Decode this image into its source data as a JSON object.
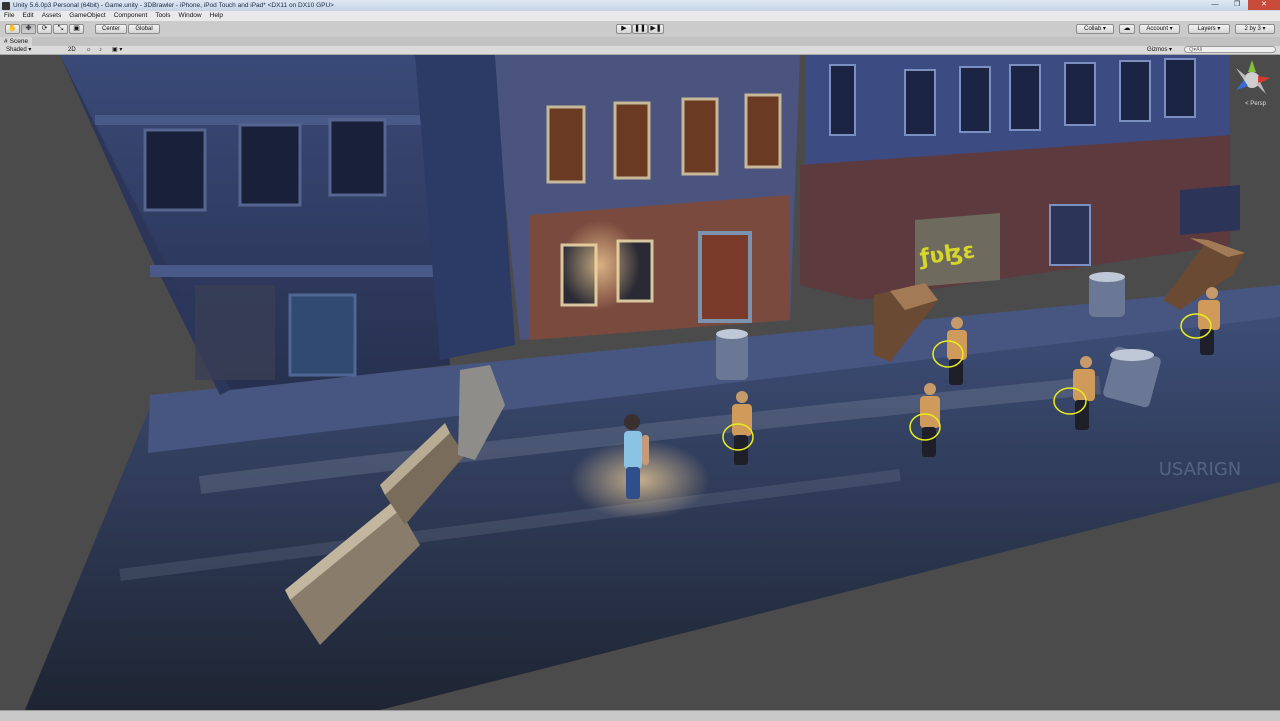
{
  "window": {
    "title": "Unity 5.6.0p3 Personal (64bit) - Game.unity - 3DBrawler - iPhone, iPod Touch and iPad* <DX11 on DX10 GPU>",
    "buttons": [
      "—",
      "❐",
      "✕"
    ]
  },
  "menu": [
    "File",
    "Edit",
    "Assets",
    "GameObject",
    "Component",
    "Tools",
    "Window",
    "Help"
  ],
  "toolbar": {
    "tools": [
      {
        "name": "hand-tool",
        "glyph": "✋"
      },
      {
        "name": "move-tool",
        "glyph": "✥"
      },
      {
        "name": "rotate-tool",
        "glyph": "⟳"
      },
      {
        "name": "scale-tool",
        "glyph": "⤡"
      },
      {
        "name": "rect-tool",
        "glyph": "▣"
      }
    ],
    "pivot_label": "Center",
    "space_label": "Global",
    "play_glyph": "▶",
    "pause_glyph": "❚❚",
    "step_glyph": "▶❚",
    "collab_label": "Collab ▾",
    "cloud_glyph": "☁",
    "account_label": "Account ▾",
    "layers_label": "Layers ▾",
    "layout_label": "2 by 3 ▾"
  },
  "scene_tab": {
    "label": "Scene",
    "glyph": "#"
  },
  "scene_toolbar": {
    "shading_mode": "Shaded ▾",
    "mode_2d": "2D",
    "light_glyph": "☼",
    "audio_glyph": "♪",
    "effects_glyph": "▣ ▾",
    "gizmos_label": "Gizmos ▾",
    "search_placeholder": "Q▾All"
  },
  "viewport": {
    "projection_label": "< Persp",
    "watermark": "USARIGN"
  },
  "colors": {
    "accent_yellow": "#e9ee1a",
    "graffiti_yellow": "#d7d62a",
    "street_blue": "#3d4f7a"
  }
}
